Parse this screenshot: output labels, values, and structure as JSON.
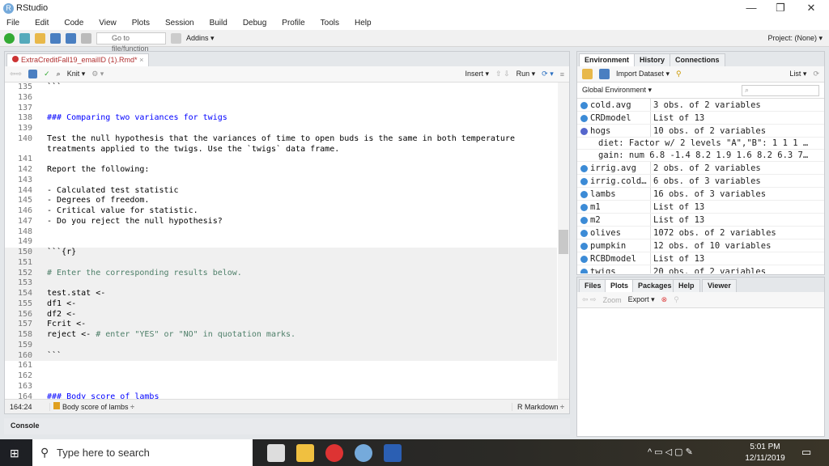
{
  "window": {
    "title": "RStudio",
    "minimize": "—",
    "restore": "❐",
    "close": "✕"
  },
  "menu": [
    "File",
    "Edit",
    "Code",
    "View",
    "Plots",
    "Session",
    "Build",
    "Debug",
    "Profile",
    "Tools",
    "Help"
  ],
  "toolbar": {
    "goto_placeholder": "Go to file/function",
    "addins": "Addins ▾",
    "project": "Project: (None) ▾"
  },
  "editor": {
    "tab": "ExtraCreditFall19_emailID (1).Rmd*",
    "knit": "Knit ▾",
    "insert": "Insert ▾",
    "run": "Run ▾",
    "lines": [
      {
        "n": "135",
        "seg": [
          [
            "",
            "```"
          ]
        ]
      },
      {
        "n": "136",
        "seg": []
      },
      {
        "n": "137",
        "seg": []
      },
      {
        "n": "138",
        "seg": [
          [
            "h",
            "### Comparing two variances for twigs"
          ]
        ]
      },
      {
        "n": "139",
        "seg": []
      },
      {
        "n": "140",
        "wrap": true,
        "seg": [
          [
            "",
            "Test the null hypothesis that the variances of time to open buds is the same in both temperature treatments applied to the twigs. Use the `twigs` data frame."
          ]
        ]
      },
      {
        "n": "141",
        "seg": []
      },
      {
        "n": "142",
        "seg": [
          [
            "",
            "Report the following:"
          ]
        ]
      },
      {
        "n": "143",
        "seg": []
      },
      {
        "n": "144",
        "seg": [
          [
            "",
            "- Calculated test statistic"
          ]
        ]
      },
      {
        "n": "145",
        "seg": [
          [
            "",
            "- Degrees of freedom."
          ]
        ]
      },
      {
        "n": "146",
        "seg": [
          [
            "",
            "- Critical value for statistic."
          ]
        ]
      },
      {
        "n": "147",
        "seg": [
          [
            "",
            "- Do you reject the null hypothesis?"
          ]
        ]
      },
      {
        "n": "148",
        "seg": []
      },
      {
        "n": "149",
        "seg": []
      },
      {
        "n": "150",
        "chunk": true,
        "seg": [
          [
            "",
            "```{r}"
          ]
        ]
      },
      {
        "n": "151",
        "chunk": true,
        "seg": []
      },
      {
        "n": "152",
        "chunk": true,
        "seg": [
          [
            "c",
            "# Enter the corresponding results below."
          ]
        ]
      },
      {
        "n": "153",
        "chunk": true,
        "seg": []
      },
      {
        "n": "154",
        "chunk": true,
        "seg": [
          [
            "",
            "test.stat <-"
          ]
        ]
      },
      {
        "n": "155",
        "chunk": true,
        "seg": [
          [
            "",
            "df1 <-"
          ]
        ]
      },
      {
        "n": "156",
        "chunk": true,
        "seg": [
          [
            "",
            "df2 <-"
          ]
        ]
      },
      {
        "n": "157",
        "chunk": true,
        "seg": [
          [
            "",
            "Fcrit <-"
          ]
        ]
      },
      {
        "n": "158",
        "chunk": true,
        "seg": [
          [
            "",
            "reject <- "
          ],
          [
            "c",
            "# enter \"YES\" or \"NO\" in quotation marks."
          ]
        ]
      },
      {
        "n": "159",
        "chunk": true,
        "seg": []
      },
      {
        "n": "160",
        "chunk": true,
        "seg": [
          [
            "",
            "```"
          ]
        ]
      },
      {
        "n": "161",
        "seg": []
      },
      {
        "n": "162",
        "seg": []
      },
      {
        "n": "163",
        "seg": []
      },
      {
        "n": "164",
        "seg": [
          [
            "h",
            "### Body score of lambs"
          ]
        ]
      }
    ],
    "status": {
      "pos": "164:24",
      "section": "Body score of lambs ÷",
      "mode": "R Markdown ÷"
    }
  },
  "console": {
    "label": "Console"
  },
  "env": {
    "tabs": [
      "Environment",
      "History",
      "Connections"
    ],
    "import": "Import Dataset ▾",
    "list": "List ▾",
    "scope": "Global Environment ▾",
    "rows": [
      {
        "name": "cold.avg",
        "value": "3 obs. of 2 variables"
      },
      {
        "name": "CRDmodel",
        "value": "List of 13"
      },
      {
        "name": "hogs",
        "value": "10 obs. of 2 variables",
        "expanded": true
      },
      {
        "sub": "diet: Factor w/ 2 levels \"A\",\"B\": 1 1 1 …"
      },
      {
        "sub": "gain: num 6.8 -1.4 8.2 1.9 1.6 8.2 6.3 7…"
      },
      {
        "name": "irrig.avg",
        "value": "2 obs. of 2 variables"
      },
      {
        "name": "irrig.cold…",
        "value": "6 obs. of 3 variables"
      },
      {
        "name": "lambs",
        "value": "16 obs. of 3 variables"
      },
      {
        "name": "m1",
        "value": "List of 13"
      },
      {
        "name": "m2",
        "value": "List of 13"
      },
      {
        "name": "olives",
        "value": "1072 obs. of 2 variables"
      },
      {
        "name": "pumpkin",
        "value": "12 obs. of 10 variables"
      },
      {
        "name": "RCBDmodel",
        "value": "List of 13"
      },
      {
        "name": "twigs",
        "value": "20 obs. of 2 variables"
      }
    ]
  },
  "files": {
    "tabs": [
      "Files",
      "Plots",
      "Packages",
      "Help",
      "Viewer"
    ],
    "zoom": "Zoom",
    "export": "Export ▾"
  },
  "taskbar": {
    "search": "Type here to search",
    "time": "5:01 PM",
    "date": "12/11/2019"
  }
}
